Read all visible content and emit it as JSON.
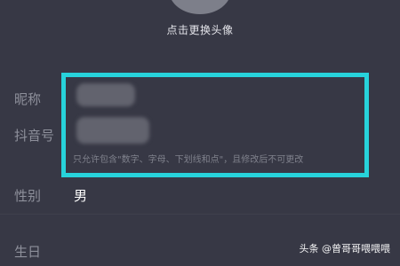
{
  "profile": {
    "avatar_caption": "点击更换头像",
    "fields": {
      "nickname_label": "昵称",
      "douyin_id_label": "抖音号",
      "gender_label": "性别",
      "gender_value": "男",
      "birthday_label": "生日"
    },
    "id_hint": "只允许包含\"数字、字母、下划线和点\"，且修改后不可更改"
  },
  "overlay": {
    "highlight_color": "#27d3db",
    "watermark": "头条 @曾哥哥喂喂喂"
  },
  "colors": {
    "background": "#373845",
    "label": "#8e909b",
    "value": "#ffffff"
  }
}
